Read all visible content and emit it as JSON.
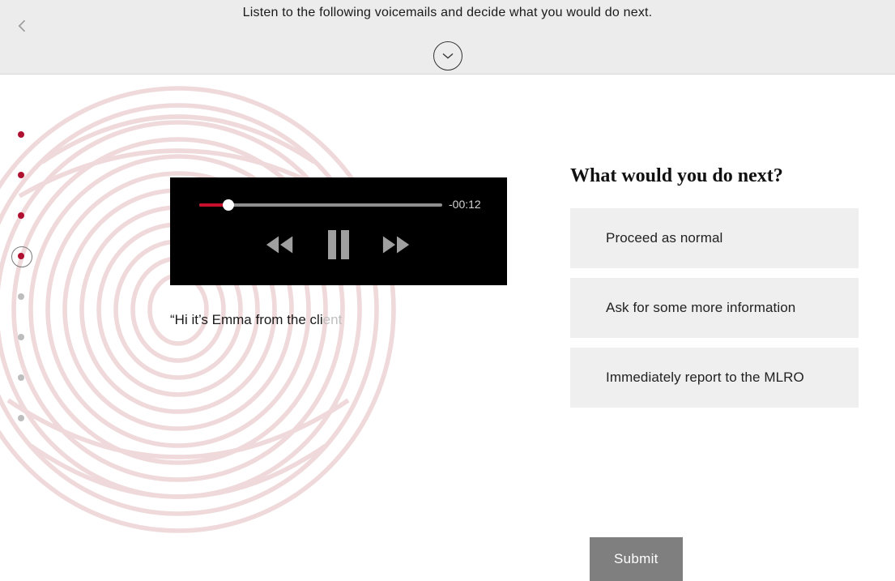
{
  "header": {
    "instruction": "Listen to the following voicemails and decide what you would do next."
  },
  "player": {
    "time_remaining": "-00:12",
    "progress_percent": 12
  },
  "transcript": {
    "visible_text": "“Hi it’s Emma from the cli",
    "fading_text": "ent"
  },
  "question": {
    "title": "What would you do next?",
    "options": [
      "Proceed as normal",
      "Ask for some more information",
      "Immediately report to the MLRO"
    ],
    "submit_label": "Submit"
  },
  "progress": {
    "steps": [
      {
        "state": "done"
      },
      {
        "state": "done"
      },
      {
        "state": "done"
      },
      {
        "state": "current"
      },
      {
        "state": "inactive"
      },
      {
        "state": "inactive"
      },
      {
        "state": "inactive"
      },
      {
        "state": "inactive"
      }
    ]
  }
}
